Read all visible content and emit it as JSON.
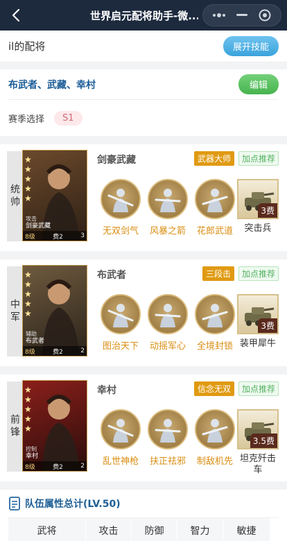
{
  "app": {
    "title": "世界启元配将助手-微...",
    "back_icon": "chevron-left-icon",
    "capsule_icons": [
      "more-dots-icon",
      "minimize-icon",
      "record-icon"
    ]
  },
  "header": {
    "name": "il的配将",
    "expand_button": "展开技能"
  },
  "lineup": {
    "names": "布武者、武藏、幸村",
    "edit_button": "编辑",
    "season_label": "赛季选择",
    "season_value": "S1"
  },
  "generals": [
    {
      "position": "统帅",
      "name": "剑豪武藏",
      "portrait_tag": "攻击",
      "portrait_name": "剑豪武藏",
      "level": "8级",
      "cost": "费2",
      "count": "3",
      "badge": "武器大师",
      "recommend": "加点推荐",
      "skills": [
        "无双剑气",
        "风暴之箭",
        "花郎武道"
      ],
      "troop": {
        "name": "突击兵",
        "cost": "3费"
      },
      "colors": {
        "bg1": "#6b4a2c",
        "bg2": "#2e1f14"
      }
    },
    {
      "position": "中军",
      "name": "布武者",
      "portrait_tag": "辅助",
      "portrait_name": "布武者",
      "level": "8级",
      "cost": "费2",
      "count": "2",
      "badge": "三段击",
      "recommend": "加点推荐",
      "skills": [
        "图治天下",
        "动摇军心",
        "全境封锁"
      ],
      "troop": {
        "name": "装甲犀牛",
        "cost": "3费"
      },
      "colors": {
        "bg1": "#6e5a3e",
        "bg2": "#2b231a"
      }
    },
    {
      "position": "前锋",
      "name": "幸村",
      "portrait_tag": "控制",
      "portrait_name": "幸村",
      "level": "8级",
      "cost": "费2",
      "count": "2",
      "badge": "信念无双",
      "recommend": "加点推荐",
      "skills": [
        "乱世神枪",
        "扶正祛邪",
        "制敌机先"
      ],
      "troop": {
        "name": "坦克歼击车",
        "cost": "3.5费"
      },
      "colors": {
        "bg1": "#8a1f1a",
        "bg2": "#2a0d0b"
      }
    }
  ],
  "summary": {
    "title": "队伍属性总计(LV.50)",
    "columns": [
      "武将",
      "攻击",
      "防御",
      "智力",
      "敏捷"
    ]
  }
}
